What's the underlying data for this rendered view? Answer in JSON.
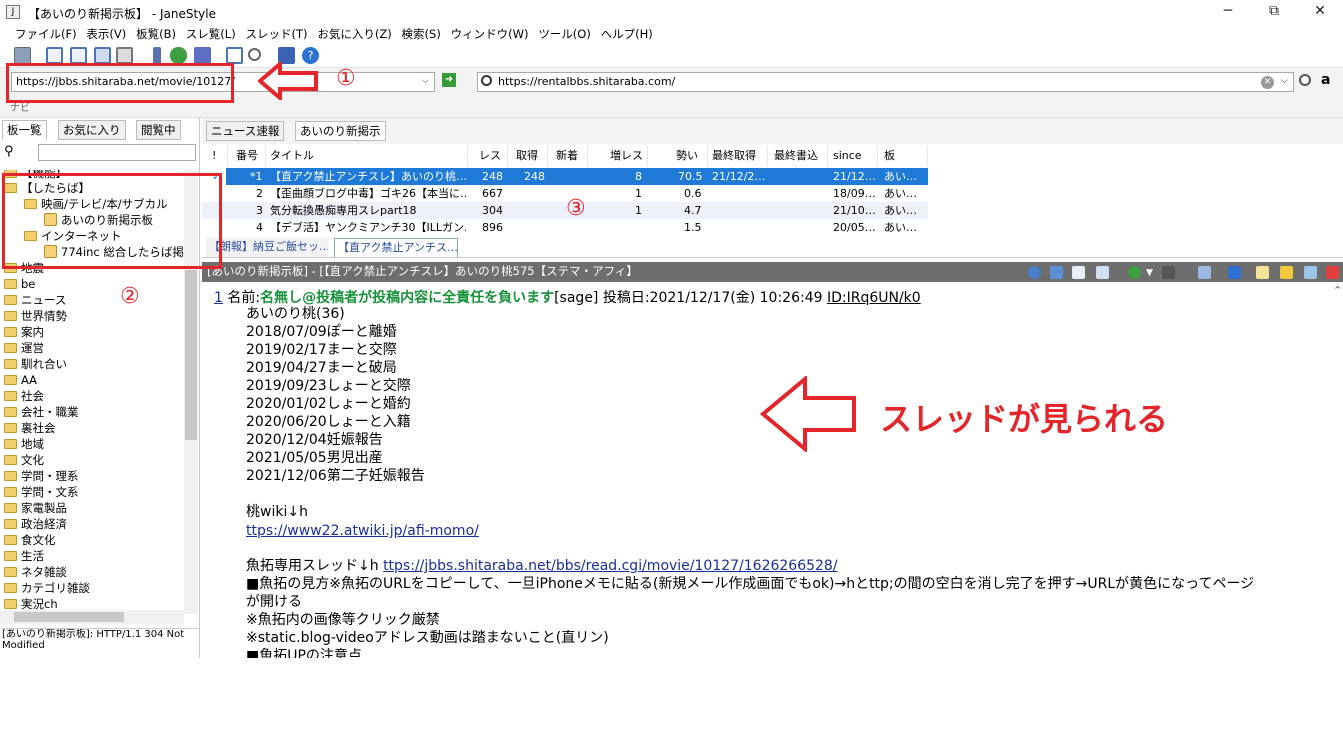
{
  "window": {
    "title": "【あいのり新掲示板】 - JaneStyle",
    "app_icon": "J",
    "minimize": "─",
    "restore": "⧉",
    "close": "✕"
  },
  "menu": [
    "ファイル(F)",
    "表示(V)",
    "板覧(B)",
    "スレ覧(L)",
    "スレッド(T)",
    "お気に入り(Z)",
    "検索(S)",
    "ウィンドウ(W)",
    "ツール(O)",
    "ヘルプ(H)"
  ],
  "toolbar": {
    "icons": [
      "newsroom-icon",
      "pane-single-icon",
      "pane-split-icon",
      "pane-vsplit-icon",
      "pane-hsplit-icon",
      "pen-icon",
      "refresh-icon",
      "save-icon",
      "window-icon",
      "search-icon",
      "board-icon",
      "help-icon"
    ]
  },
  "address": {
    "url": "https://jbbs.shitaraba.net/movie/10127/",
    "search_value": "https://rentalbbs.shitaraba.com/",
    "nav_label": "ナビ"
  },
  "left": {
    "tabs": [
      "板一覧",
      "お気に入り",
      "閲覧中"
    ],
    "tree": [
      "【機能】",
      "【したらば】",
      "映画/テレビ/本/サブカル",
      "あいのり新掲示板",
      "インターネット",
      "774inc 総合したらば掲示",
      "地震",
      "be",
      "ニュース",
      "世界情勢",
      "案内",
      "運営",
      "馴れ合い",
      "AA",
      "社会",
      "会社・職業",
      "裏社会",
      "地域",
      "文化",
      "学問・理系",
      "学問・文系",
      "家電製品",
      "政治経済",
      "食文化",
      "生活",
      "ネタ雑談",
      "カテゴリ雑談",
      "実況ch"
    ],
    "status": "[あいのり新掲示板]: HTTP/1.1 304 Not Modified"
  },
  "thread_tabs": [
    "ニュース速報",
    "あいのり新掲示"
  ],
  "thread_list": {
    "columns": [
      "!",
      "番号",
      "タイトル",
      "レス",
      "取得",
      "新着",
      "増レス",
      "勢い",
      "最終取得",
      "最終書込",
      "since",
      "板"
    ],
    "rows": [
      {
        "mark": "✓",
        "num": "*1",
        "title": "【直アク禁止アンチスレ】あいのり桃…",
        "res": "248",
        "got": "248",
        "new": "",
        "inc": "8",
        "speed": "70.5",
        "last_got": "21/12/2…",
        "last_write": "",
        "since": "21/12…",
        "board": "あい…"
      },
      {
        "mark": "",
        "num": "2",
        "title": "【歪曲顔ブログ中毒】ゴキ26【本当に…",
        "res": "667",
        "got": "",
        "new": "",
        "inc": "1",
        "speed": "0.6",
        "last_got": "",
        "last_write": "",
        "since": "18/09…",
        "board": "あい…"
      },
      {
        "mark": "",
        "num": "3",
        "title": "気分転換愚痴専用スレpart18",
        "res": "304",
        "got": "",
        "new": "",
        "inc": "1",
        "speed": "4.7",
        "last_got": "",
        "last_write": "",
        "since": "21/10…",
        "board": "あい…"
      },
      {
        "mark": "",
        "num": "4",
        "title": "【デブ活】ヤンクミアンチ30【ILLガン…",
        "res": "896",
        "got": "",
        "new": "",
        "inc": "",
        "speed": "1.5",
        "last_got": "",
        "last_write": "",
        "since": "20/05…",
        "board": "あい…"
      }
    ]
  },
  "open_tabs": [
    "【朗報】納豆ご飯セッ…",
    "【直アク禁止アンチス…"
  ],
  "thread": {
    "header": "[あいのり新掲示板] - [【直アク禁止アンチスレ】あいのり桃575【ステマ・アフィ】",
    "post_num": "1",
    "name_label": "名前:",
    "name": "名無し@投稿者が投稿内容に全責任を負います",
    "sage": "[sage]",
    "date": "投稿日:2021/12/17(金) 10:26:49",
    "id": "ID:IRq6UN/k0",
    "lines": [
      "あいのり桃(36)",
      "2018/07/09ぽーと離婚",
      "2019/02/17まーと交際",
      "2019/04/27まーと破局",
      "2019/09/23しょーと交際",
      "2020/01/02しょーと婚約",
      "2020/06/20しょーと入籍",
      "2020/12/04妊娠報告",
      "2021/05/05男児出産",
      "2021/12/06第二子妊娠報告",
      "",
      "桃wiki↓h"
    ],
    "link1": "ttps://www22.atwiki.jp/afi-momo/",
    "gyotaku_label": "魚拓専用スレッド↓h",
    "gyotaku_link": "ttps://jbbs.shitaraba.net/bbs/read.cgi/movie/10127/1626266528/",
    "lines2": [
      "■魚拓の見方※魚拓のURLをコピーして、一旦iPhoneメモに貼る(新規メール作成画面でもok)→hとttp;の間の空白を消し完了を押す→URLが黄色になってページ",
      "が開ける",
      "※魚拓内の画像等クリック厳禁",
      "※static.blog-videoアドレス動画は踏まないこと(直リン)",
      "■魚拓UPの注意点"
    ]
  },
  "annotations": {
    "circle1": "①",
    "circle2": "②",
    "circle3": "③",
    "caption": "スレッドが見られる"
  },
  "colors": {
    "accent": "#e4262b",
    "selected_row": "#1e7ad6",
    "name_green": "#17913a",
    "link": "#1a2e9c"
  }
}
